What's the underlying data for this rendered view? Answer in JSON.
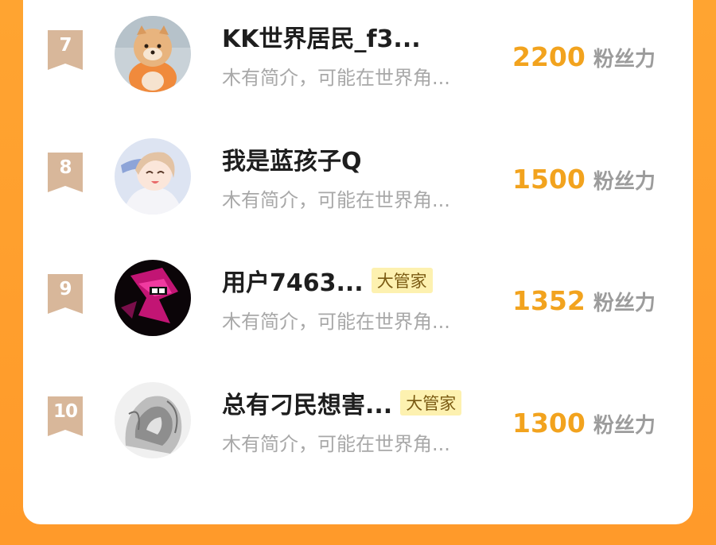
{
  "leaderboard": {
    "entries": [
      {
        "rank": "7",
        "username": "KK世界居民_f3...",
        "tag": "",
        "bio": "木有简介，可能在世界角...",
        "score": "2200",
        "score_unit": "粉丝力",
        "avatar": "avatar-shiba-dog"
      },
      {
        "rank": "8",
        "username": "我是蓝孩子Q",
        "tag": "",
        "bio": "木有简介，可能在世界角...",
        "score": "1500",
        "score_unit": "粉丝力",
        "avatar": "avatar-anime-girl"
      },
      {
        "rank": "9",
        "username": "用户7463...",
        "tag": "大管家",
        "bio": "木有简介，可能在世界角...",
        "score": "1352",
        "score_unit": "粉丝力",
        "avatar": "avatar-dark-magenta"
      },
      {
        "rank": "10",
        "username": "总有刁民想害...",
        "tag": "大管家",
        "bio": "木有简介，可能在世界角...",
        "score": "1300",
        "score_unit": "粉丝力",
        "avatar": "avatar-grayscale-sketch"
      }
    ]
  },
  "colors": {
    "background": "#FF9F2E",
    "card": "#FFFFFF",
    "rank_badge": "#D8B79A",
    "score": "#F2A31E",
    "tag_bg": "#FDF1B0"
  }
}
